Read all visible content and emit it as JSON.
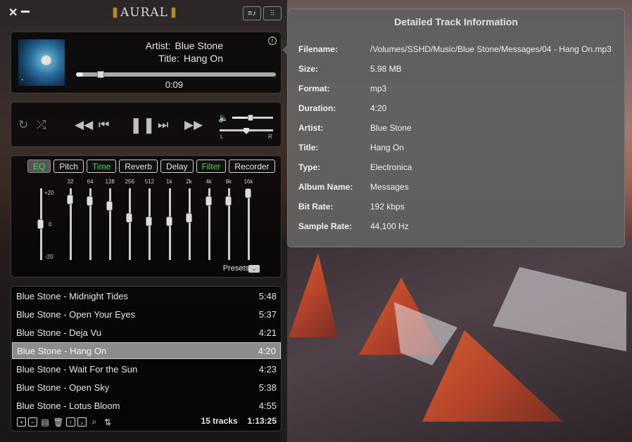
{
  "app": {
    "logo_text": "AURAL"
  },
  "now_playing": {
    "artist_label": "Artist:",
    "artist": "Blue Stone",
    "title_label": "Title:",
    "title": "Hang On",
    "elapsed": "0:09",
    "progress_fraction": 0.035
  },
  "controls": {
    "volume_fraction": 0.45,
    "pan_fraction": 0.5,
    "pan_left": "L",
    "pan_right": "R"
  },
  "effects": {
    "tabs": [
      {
        "label": "EQ",
        "active": true,
        "enabled": true
      },
      {
        "label": "Pitch",
        "active": false,
        "enabled": false
      },
      {
        "label": "Time",
        "active": false,
        "enabled": true
      },
      {
        "label": "Reverb",
        "active": false,
        "enabled": false
      },
      {
        "label": "Delay",
        "active": false,
        "enabled": false
      },
      {
        "label": "Filter",
        "active": false,
        "enabled": true
      },
      {
        "label": "Recorder",
        "active": false,
        "enabled": false
      }
    ],
    "scale_top": "+20",
    "scale_mid": "0",
    "scale_bottom": "-20",
    "global_gain_db": 0,
    "bands": [
      {
        "freq": "32",
        "gain_db": 16
      },
      {
        "freq": "64",
        "gain_db": 15
      },
      {
        "freq": "128",
        "gain_db": 12
      },
      {
        "freq": "256",
        "gain_db": 4
      },
      {
        "freq": "512",
        "gain_db": 2
      },
      {
        "freq": "1k",
        "gain_db": 2
      },
      {
        "freq": "2k",
        "gain_db": 4
      },
      {
        "freq": "4k",
        "gain_db": 15
      },
      {
        "freq": "8k",
        "gain_db": 15
      },
      {
        "freq": "16k",
        "gain_db": 20
      }
    ],
    "presets_label": "Presets"
  },
  "playlist": {
    "tracks": [
      {
        "name": "Blue Stone - Midnight Tides",
        "duration": "5:48",
        "selected": false
      },
      {
        "name": "Blue Stone - Open Your Eyes",
        "duration": "5:37",
        "selected": false
      },
      {
        "name": "Blue Stone - Deja Vu",
        "duration": "4:21",
        "selected": false
      },
      {
        "name": "Blue Stone - Hang On",
        "duration": "4:20",
        "selected": true
      },
      {
        "name": "Blue Stone - Wait For the Sun",
        "duration": "4:23",
        "selected": false
      },
      {
        "name": "Blue Stone - Open Sky",
        "duration": "5:38",
        "selected": false
      },
      {
        "name": "Blue Stone - Lotus Bloom",
        "duration": "4:55",
        "selected": false
      }
    ],
    "track_count": "15 tracks",
    "total_duration": "1:13:25"
  },
  "track_info": {
    "title": "Detailed Track Information",
    "fields": [
      {
        "key": "Filename:",
        "value": "/Volumes/SSHD/Music/Blue Stone/Messages/04 - Hang On.mp3"
      },
      {
        "key": "Size:",
        "value": "5.98 MB"
      },
      {
        "key": "Format:",
        "value": "mp3"
      },
      {
        "key": "Duration:",
        "value": "4:20"
      },
      {
        "key": "Artist:",
        "value": "Blue Stone"
      },
      {
        "key": "Title:",
        "value": "Hang On"
      },
      {
        "key": "Type:",
        "value": "Electronica"
      },
      {
        "key": "Album Name:",
        "value": "Messages"
      },
      {
        "key": "Bit Rate:",
        "value": "192 kbps"
      },
      {
        "key": "Sample Rate:",
        "value": "44,100 Hz"
      }
    ]
  }
}
